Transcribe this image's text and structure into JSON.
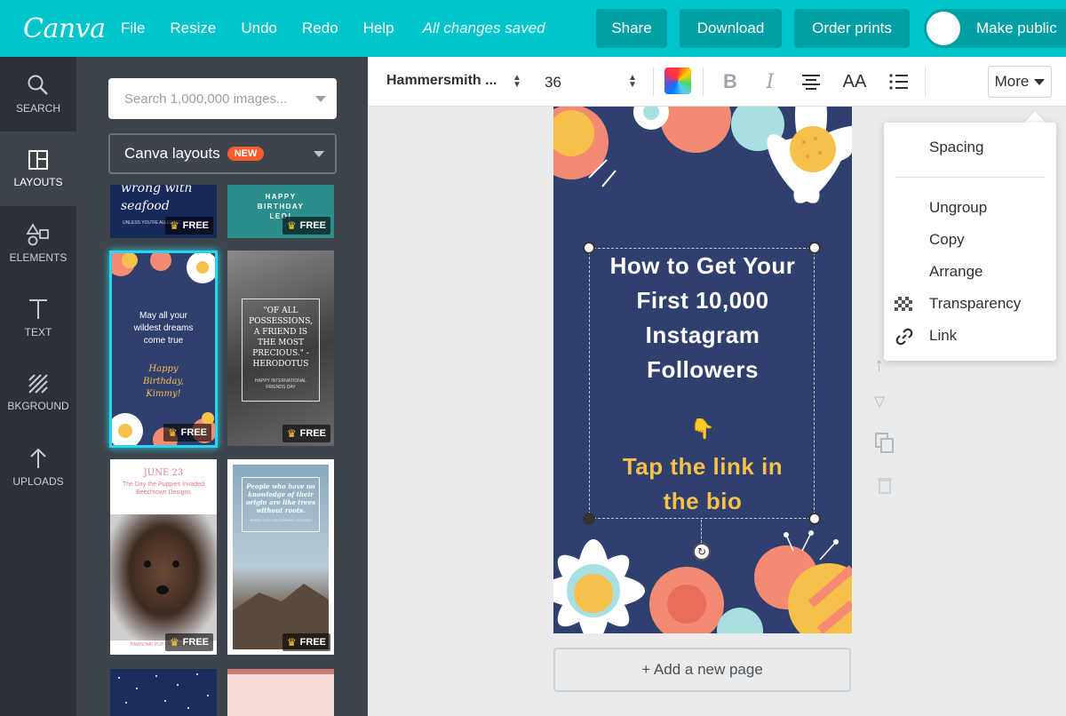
{
  "app": {
    "logo": "Canva",
    "menu": [
      "File",
      "Resize",
      "Undo",
      "Redo",
      "Help"
    ],
    "status": "All changes saved",
    "share_label": "Share",
    "download_label": "Download",
    "order_prints_label": "Order prints",
    "make_public_label": "Make public"
  },
  "rail": {
    "items": [
      {
        "label": "SEARCH",
        "icon": "search-icon"
      },
      {
        "label": "LAYOUTS",
        "icon": "layouts-icon",
        "active": true
      },
      {
        "label": "ELEMENTS",
        "icon": "elements-icon"
      },
      {
        "label": "TEXT",
        "icon": "text-icon"
      },
      {
        "label": "BKGROUND",
        "icon": "background-icon"
      },
      {
        "label": "UPLOADS",
        "icon": "upload-icon"
      }
    ]
  },
  "panel": {
    "search_placeholder": "Search 1,000,000 images...",
    "layouts_label": "Canva layouts",
    "new_badge": "NEW",
    "free_label": "FREE",
    "thumbs": {
      "t1_line1": "wrong with",
      "t1_line2": "seafood",
      "t1_small": "UNLESS YOU'RE ALLERGIC",
      "t2_line1": "HAPPY",
      "t2_line2": "BIRTHDAY",
      "t2_line3": "LEO!",
      "t3_text": "May all your wildest dreams come true",
      "t3_script": "Happy Birthday, Kimmy!",
      "t4_quote": "\"OF ALL POSSESSIONS, A FRIEND IS THE MOST PRECIOUS.\" - HERODOTUS",
      "t4_small": "HAPPY INTERNATIONAL FRIENDS DAY",
      "t5_date": "JUNE 23",
      "t5_text": "The Day the Puppies Invaded Beechtown Designs",
      "t5_small": "PAWSOME PUP FACE TO FACE",
      "t6_quote": "People who have no knowledge of their origin are like trees without roots.",
      "t6_small": "SHOW YOUR BELONGING, HISTORY"
    }
  },
  "toolbar": {
    "font_name": "Hammersmith ...",
    "font_size": "36",
    "more_label": "More"
  },
  "canvas": {
    "headline": "How to Get Your First 10,000 Instagram Followers",
    "pointer": "👇",
    "cta": "Tap the link in the bio",
    "add_page_label": "+ Add a new page"
  },
  "dropdown": {
    "items": [
      "Spacing",
      "Ungroup",
      "Copy",
      "Arrange",
      "Transparency",
      "Link"
    ]
  },
  "colors": {
    "brand": "#00c4cc",
    "brand_dark": "#009ea5",
    "rail_bg": "#2b3137",
    "panel_bg": "#3d444c",
    "design_bg": "#2f3f6e",
    "accent_yellow": "#f7c04a",
    "badge_orange": "#ff5b32"
  }
}
